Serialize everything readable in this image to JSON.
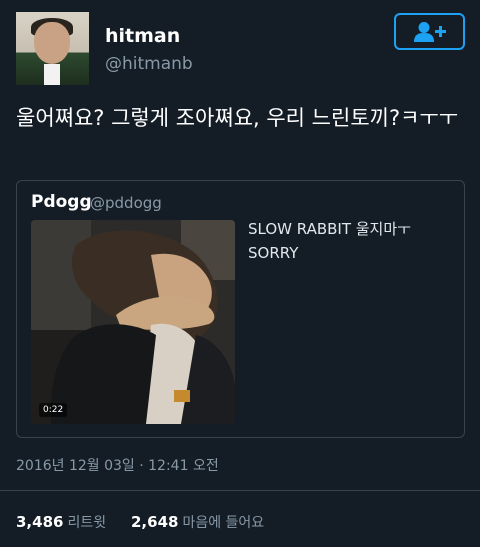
{
  "author": {
    "name": "hitman",
    "handle": "@hitmanb"
  },
  "tweet": {
    "text": "울어쪄요? 그렇게 조아쪄요, 우리 느린토끼?ㅋㅜㅜ"
  },
  "quoted_tweet": {
    "name": "Pdogg",
    "handle": "@pddogg",
    "text_line1": "SLOW RABBIT  울지마ㅜ",
    "text_line2": "SORRY",
    "video_duration": "0:22"
  },
  "meta": {
    "timestamp": "2016년 12월 03일 · 12:41 오전"
  },
  "stats": {
    "retweets_count": "3,486",
    "retweets_label": "리트윗",
    "likes_count": "2,648",
    "likes_label": "마음에 들어요"
  },
  "colors": {
    "background": "#141d26",
    "accent": "#1da1f2",
    "secondary_text": "#8899a6",
    "border": "#38444d"
  },
  "icons": {
    "follow": "add-user-icon"
  }
}
